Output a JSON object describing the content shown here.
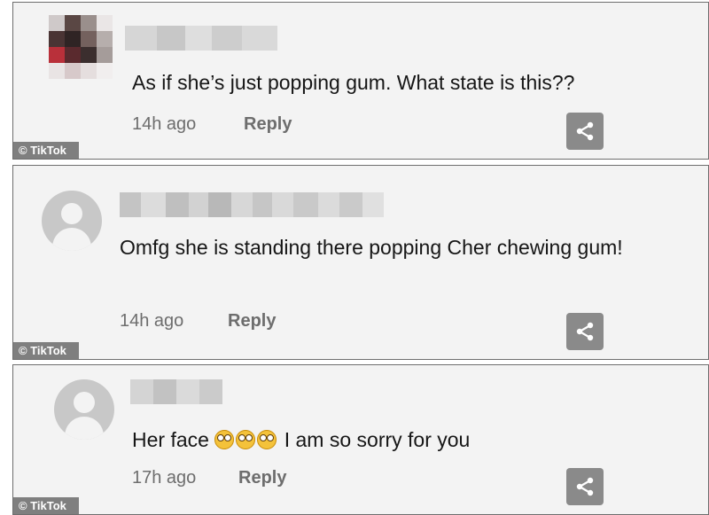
{
  "comments": [
    {
      "text": "As if she’s just popping gum. What state is this??",
      "time": "14h ago",
      "reply_label": "Reply"
    },
    {
      "text": "Omfg she is standing there popping Cher chewing gum!",
      "time": "14h ago",
      "reply_label": "Reply"
    },
    {
      "text_before": "Her face ",
      "emojis": [
        "flushed-face",
        "flushed-face",
        "flushed-face"
      ],
      "text_after": " I am so sorry for you",
      "time": "17h ago",
      "reply_label": "Reply"
    }
  ],
  "watermark": "© TikTok",
  "icons": {
    "share": "share-icon",
    "avatar_default": "default-avatar-icon"
  },
  "colors": {
    "card_background": "#f3f3f3",
    "share_button": "#8a8a8a",
    "meta_text": "#6d6d6d",
    "watermark_bg": "#7f7f7f"
  }
}
